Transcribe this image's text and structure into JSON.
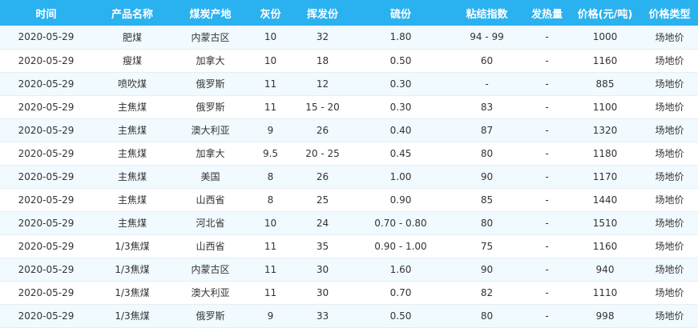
{
  "table": {
    "headers": [
      "时间",
      "产品名称",
      "煤炭产地",
      "灰份",
      "挥发份",
      "硫份",
      "粘结指数",
      "发热量",
      "价格(元/吨)",
      "价格类型"
    ],
    "rows": [
      [
        "2020-05-29",
        "肥煤",
        "内蒙古区",
        "10",
        "32",
        "1.80",
        "94 - 99",
        "-",
        "1000",
        "场地价"
      ],
      [
        "2020-05-29",
        "瘦煤",
        "加拿大",
        "10",
        "18",
        "0.50",
        "60",
        "-",
        "1160",
        "场地价"
      ],
      [
        "2020-05-29",
        "喷吹煤",
        "俄罗斯",
        "11",
        "12",
        "0.30",
        "-",
        "-",
        "885",
        "场地价"
      ],
      [
        "2020-05-29",
        "主焦煤",
        "俄罗斯",
        "11",
        "15 - 20",
        "0.30",
        "83",
        "-",
        "1100",
        "场地价"
      ],
      [
        "2020-05-29",
        "主焦煤",
        "澳大利亚",
        "9",
        "26",
        "0.40",
        "87",
        "-",
        "1320",
        "场地价"
      ],
      [
        "2020-05-29",
        "主焦煤",
        "加拿大",
        "9.5",
        "20 - 25",
        "0.45",
        "80",
        "-",
        "1180",
        "场地价"
      ],
      [
        "2020-05-29",
        "主焦煤",
        "美国",
        "8",
        "26",
        "1.00",
        "90",
        "-",
        "1170",
        "场地价"
      ],
      [
        "2020-05-29",
        "主焦煤",
        "山西省",
        "8",
        "25",
        "0.90",
        "85",
        "-",
        "1440",
        "场地价"
      ],
      [
        "2020-05-29",
        "主焦煤",
        "河北省",
        "10",
        "24",
        "0.70 - 0.80",
        "80",
        "-",
        "1510",
        "场地价"
      ],
      [
        "2020-05-29",
        "1/3焦煤",
        "山西省",
        "11",
        "35",
        "0.90 - 1.00",
        "75",
        "-",
        "1160",
        "场地价"
      ],
      [
        "2020-05-29",
        "1/3焦煤",
        "内蒙古区",
        "11",
        "30",
        "1.60",
        "90",
        "-",
        "940",
        "场地价"
      ],
      [
        "2020-05-29",
        "1/3焦煤",
        "澳大利亚",
        "11",
        "30",
        "0.70",
        "82",
        "-",
        "1110",
        "场地价"
      ],
      [
        "2020-05-29",
        "1/3焦煤",
        "俄罗斯",
        "9",
        "33",
        "0.50",
        "80",
        "-",
        "998",
        "场地价"
      ]
    ]
  },
  "colors": {
    "header_bg": "#2ab1f0",
    "header_text": "#ffffff",
    "row_alt_bg": "#f1fafe",
    "row_bg": "#ffffff",
    "cell_text": "#333333"
  }
}
